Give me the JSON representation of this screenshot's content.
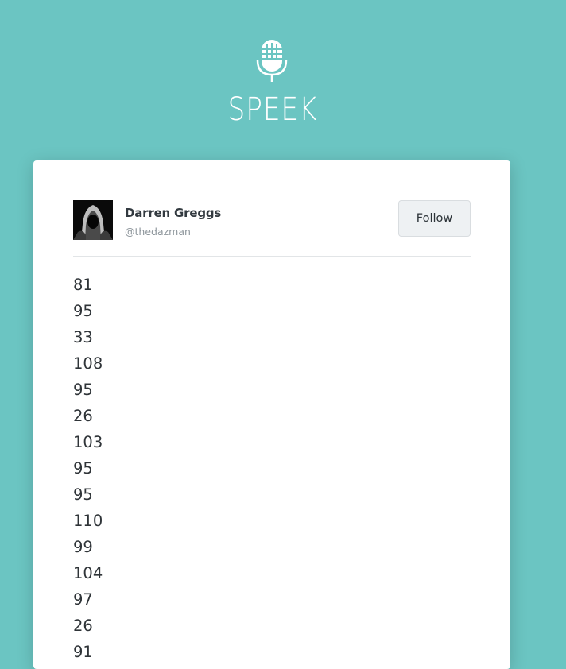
{
  "app": {
    "brand_name": "SPEEK",
    "logo_icon": "microphone-icon"
  },
  "profile": {
    "name": "Darren Greggs",
    "handle": "@thedazman",
    "avatar_icon": "hooded-figure-avatar",
    "follow_label": "Follow"
  },
  "post": {
    "lines": [
      "81",
      "95",
      "33",
      "108",
      "95",
      "26",
      "103",
      "95",
      "95",
      "110",
      "99",
      "104",
      "97",
      "26",
      "91"
    ]
  },
  "colors": {
    "background": "#6bc5c2",
    "card": "#ffffff",
    "follow_button": "#eef1f3"
  }
}
